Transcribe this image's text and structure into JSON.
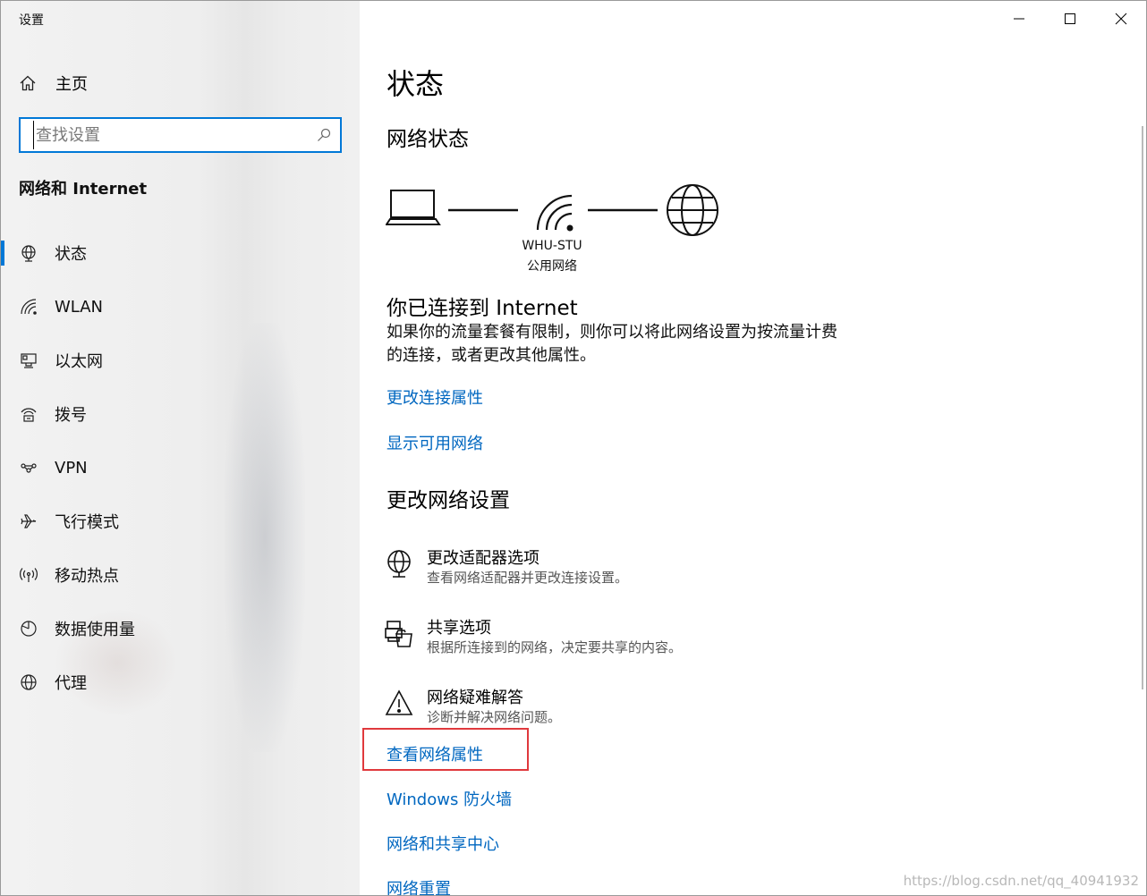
{
  "window": {
    "title": "设置"
  },
  "sidebar": {
    "home_label": "主页",
    "search_placeholder": "查找设置",
    "section_title": "网络和 Internet",
    "items": [
      {
        "label": "状态",
        "icon": "globe-status-icon",
        "active": true
      },
      {
        "label": "WLAN",
        "icon": "wifi-icon"
      },
      {
        "label": "以太网",
        "icon": "ethernet-icon"
      },
      {
        "label": "拨号",
        "icon": "dialup-icon"
      },
      {
        "label": "VPN",
        "icon": "vpn-icon"
      },
      {
        "label": "飞行模式",
        "icon": "airplane-icon"
      },
      {
        "label": "移动热点",
        "icon": "hotspot-icon"
      },
      {
        "label": "数据使用量",
        "icon": "pie-chart-icon"
      },
      {
        "label": "代理",
        "icon": "globe-icon"
      }
    ]
  },
  "main": {
    "page_title": "状态",
    "network_status_heading": "网络状态",
    "network_name": "WHU-STU",
    "network_type": "公用网络",
    "connected_title": "你已连接到 Internet",
    "connected_desc": "如果你的流量套餐有限制，则你可以将此网络设置为按流量计费的连接，或者更改其他属性。",
    "links_top": [
      "更改连接属性",
      "显示可用网络"
    ],
    "change_heading": "更改网络设置",
    "options": [
      {
        "title": "更改适配器选项",
        "desc": "查看网络适配器并更改连接设置。",
        "icon": "adapter-globe-icon"
      },
      {
        "title": "共享选项",
        "desc": "根据所连接到的网络，决定要共享的内容。",
        "icon": "sharing-icon"
      },
      {
        "title": "网络疑难解答",
        "desc": "诊断并解决网络问题。",
        "icon": "warning-icon"
      }
    ],
    "links_bottom": [
      "查看网络属性",
      "Windows 防火墙",
      "网络和共享中心",
      "网络重置"
    ]
  },
  "watermark": "https://blog.csdn.net/qq_40941932",
  "colors": {
    "accent": "#0078d7",
    "link": "#0067c0",
    "highlight_box": "#e0393d"
  }
}
